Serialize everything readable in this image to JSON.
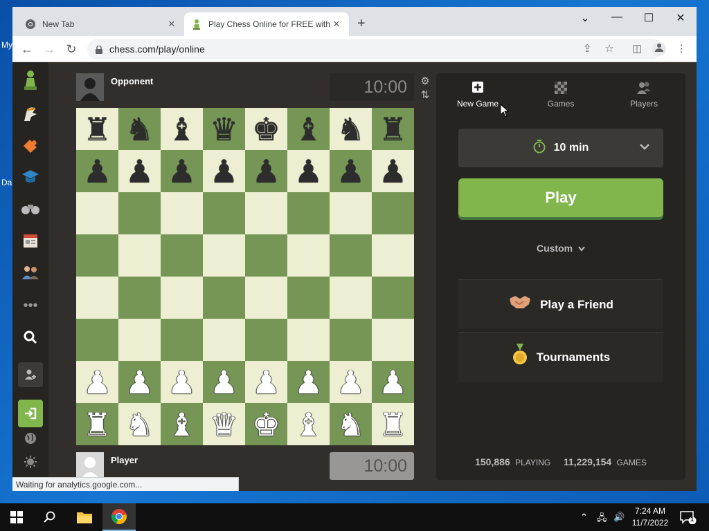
{
  "desktop": {
    "icon_label_1": "My",
    "icon_label_2": "Da"
  },
  "browser": {
    "tabs": [
      {
        "title": "New Tab",
        "icon": "chrome-icon"
      },
      {
        "title": "Play Chess Online for FREE with F",
        "icon": "pawn-icon"
      }
    ],
    "url": "chess.com/play/online",
    "status_text": "Waiting for analytics.google.com..."
  },
  "game": {
    "opponent_name": "Opponent",
    "player_name": "Player",
    "opponent_clock": "10:00",
    "player_clock": "10:00",
    "board": [
      [
        "r",
        "n",
        "b",
        "q",
        "k",
        "b",
        "n",
        "r"
      ],
      [
        "p",
        "p",
        "p",
        "p",
        "p",
        "p",
        "p",
        "p"
      ],
      [
        "",
        "",
        "",
        "",
        "",
        "",
        "",
        ""
      ],
      [
        "",
        "",
        "",
        "",
        "",
        "",
        "",
        ""
      ],
      [
        "",
        "",
        "",
        "",
        "",
        "",
        "",
        ""
      ],
      [
        "",
        "",
        "",
        "",
        "",
        "",
        "",
        ""
      ],
      [
        "P",
        "P",
        "P",
        "P",
        "P",
        "P",
        "P",
        "P"
      ],
      [
        "R",
        "N",
        "B",
        "Q",
        "K",
        "B",
        "N",
        "R"
      ]
    ]
  },
  "panel": {
    "tabs": [
      {
        "label": "New Game",
        "icon": "plus-square-icon",
        "active": true
      },
      {
        "label": "Games",
        "icon": "board-icon",
        "active": false
      },
      {
        "label": "Players",
        "icon": "players-icon",
        "active": false
      }
    ],
    "time_control": "10 min",
    "play_label": "Play",
    "custom_label": "Custom",
    "play_friend_label": "Play a Friend",
    "tournaments_label": "Tournaments",
    "playing_count": "150,886",
    "playing_label": "PLAYING",
    "games_count": "11,229,154",
    "games_label": "GAMES"
  },
  "taskbar": {
    "time": "7:24 AM",
    "date": "11/7/2022",
    "notification_count": "1"
  },
  "colors": {
    "board_light": "#eeeed2",
    "board_dark": "#769656",
    "accent_green": "#81b64c"
  }
}
